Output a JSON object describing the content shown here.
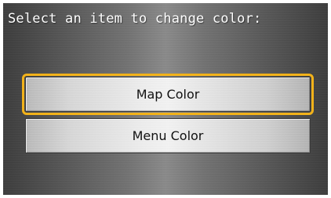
{
  "screen": {
    "title": "Select an item to change color:"
  },
  "menu": {
    "items": [
      {
        "label": "Map Color",
        "selected": true
      },
      {
        "label": "Menu Color",
        "selected": false
      }
    ]
  },
  "colors": {
    "highlight": "#f2b21a",
    "title_text": "#ffffff",
    "button_text": "#111111"
  }
}
